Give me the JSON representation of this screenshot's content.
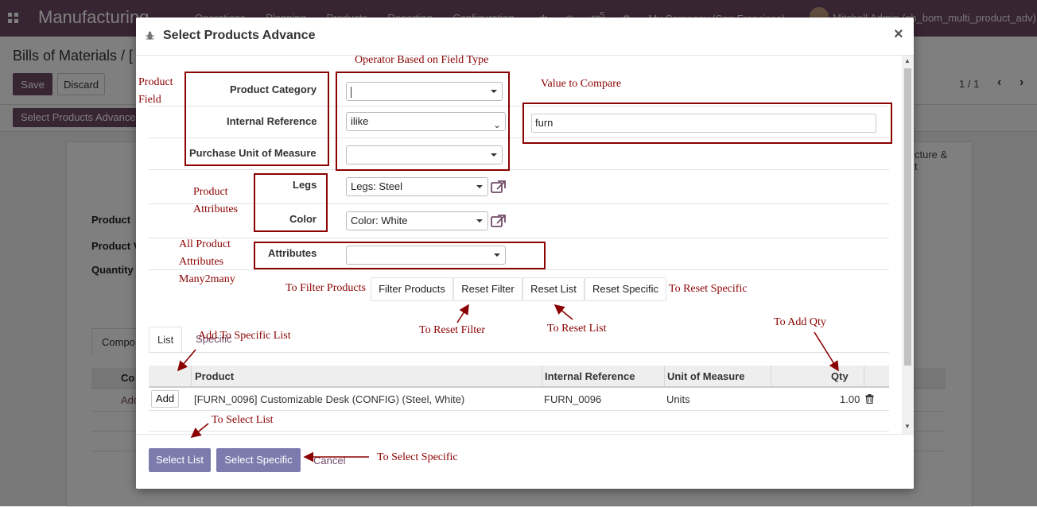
{
  "app": {
    "name": "Manufacturing",
    "menu": [
      "Operations",
      "Planning",
      "Products",
      "Reporting",
      "Configuration"
    ],
    "notification_count": "5",
    "company": "My Company (San Francisco)",
    "user": "Mitchell Admin (sh_bom_multi_product_adv)"
  },
  "control_panel": {
    "breadcrumb": "Bills of Materials / [",
    "save_label": "Save",
    "discard_label": "Discard",
    "pager": "1 / 1",
    "action_button": "Select Products Advance"
  },
  "background_form": {
    "labels": [
      "Product",
      "Product V",
      "Quantity"
    ],
    "tab_text": "cture &",
    "tab_text2": "t",
    "components_tab": "Compo",
    "column": "Co",
    "add_line": "Add"
  },
  "modal": {
    "title": "Select Products Advance",
    "close_label": "×",
    "fields": {
      "product_category": {
        "label": "Product Category",
        "value": ""
      },
      "internal_reference": {
        "label": "Internal Reference",
        "operator": "ilike",
        "value": "furn"
      },
      "purchase_uom": {
        "label": "Purchase Unit of Measure",
        "value": ""
      },
      "legs": {
        "label": "Legs",
        "value": "Legs: Steel"
      },
      "color": {
        "label": "Color",
        "value": "Color: White"
      },
      "attributes": {
        "label": "Attributes",
        "value": ""
      }
    },
    "buttons": {
      "filter_products": "Filter Products",
      "reset_filter": "Reset Filter",
      "reset_list": "Reset List",
      "reset_specific": "Reset Specific"
    },
    "tabs": [
      {
        "label": "List",
        "active": true
      },
      {
        "label": "Specific",
        "active": false
      }
    ],
    "table": {
      "columns": [
        "Product",
        "Internal Reference",
        "Unit of Measure",
        "Qty"
      ],
      "rows": [
        {
          "add_label": "Add",
          "product": "[FURN_0096] Customizable Desk (CONFIG) (Steel, White)",
          "internal_reference": "FURN_0096",
          "uom": "Units",
          "qty": "1.00"
        }
      ]
    },
    "footer": {
      "select_list": "Select List",
      "select_specific": "Select Specific",
      "cancel": "Cancel"
    }
  },
  "annotations": {
    "operator": "Operator Based on Field Type",
    "product_field_1": "Product",
    "product_field_2": "Field",
    "value_compare": "Value to Compare",
    "product_attributes_1": "Product",
    "product_attributes_2": "Attributes",
    "all_attributes_1": "All Product",
    "all_attributes_2": "Attributes",
    "all_attributes_3": "Many2many",
    "to_filter": "To Filter Products",
    "to_reset_specific": "To Reset Specific",
    "to_reset_filter": "To Reset Filter",
    "to_reset_list": "To Reset List",
    "to_add_qty": "To Add Qty",
    "add_specific": "Add To Specific List",
    "to_select_list": "To Select List",
    "to_select_specific": "To Select Specific"
  },
  "colors": {
    "brand": "#714b67",
    "primary_button": "#7c7bad",
    "annotation": "#8b0000"
  }
}
